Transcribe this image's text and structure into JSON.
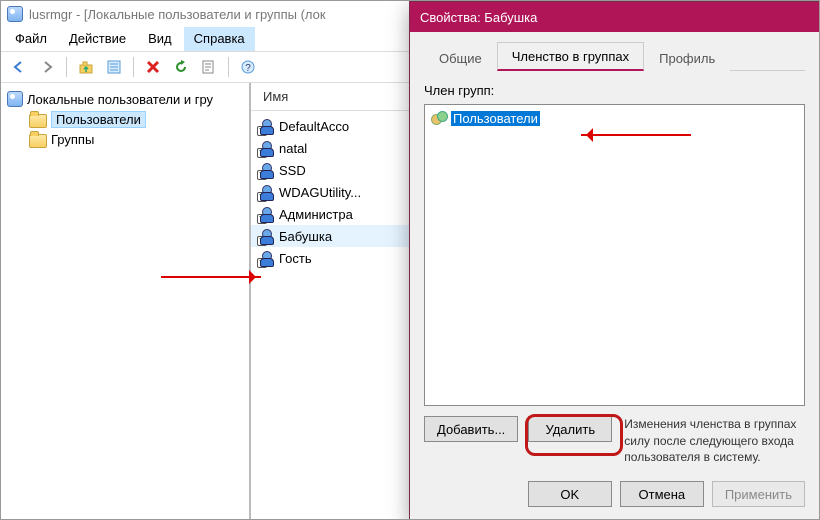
{
  "mmc": {
    "title": "lusrmgr - [Локальные пользователи и группы (лок",
    "menu": {
      "file": "Файл",
      "action": "Действие",
      "view": "Вид",
      "help": "Справка"
    },
    "nav": {
      "root": "Локальные пользователи и гру",
      "users": "Пользователи",
      "groups": "Группы"
    },
    "list": {
      "header": "Имя",
      "items": [
        "DefaultAcco",
        "natal",
        "SSD",
        "WDAGUtility...",
        "Администра",
        "Бабушка",
        "Гость"
      ],
      "selected": "Бабушка"
    }
  },
  "dialog": {
    "title": "Свойства: Бабушка",
    "tabs": {
      "general": "Общие",
      "member": "Членство в группах",
      "profile": "Профиль"
    },
    "active_tab": "member",
    "member_label": "Член групп:",
    "groups": [
      "Пользователи"
    ],
    "buttons": {
      "add": "Добавить...",
      "delete": "Удалить",
      "ok": "OK",
      "cancel": "Отмена",
      "apply": "Применить"
    },
    "note": "Изменения членства в группах силу после следующего входа пользователя в систему."
  },
  "colors": {
    "accent": "#b01657",
    "selection": "#0078d7",
    "annotate": "#d00000"
  }
}
